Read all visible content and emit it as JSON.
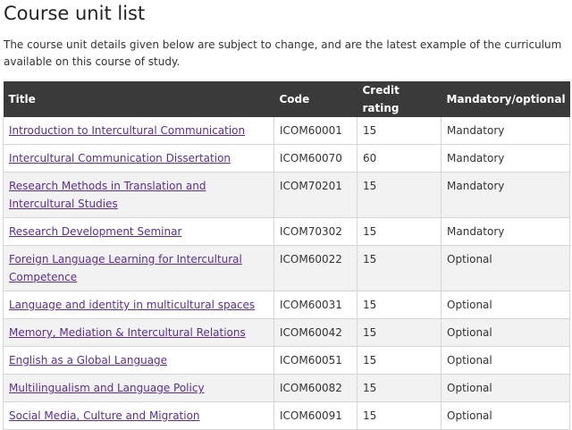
{
  "page": {
    "title": "Course unit list",
    "intro": "The course unit details given below are subject to change, and are the latest example of the curriculum available on this course of study."
  },
  "table": {
    "headers": [
      "Title",
      "Code",
      "Credit rating",
      "Mandatory/optional"
    ],
    "rows": [
      {
        "title": "Introduction to Intercultural Communication",
        "code": "ICOM60001",
        "credit": "15",
        "status": "Mandatory"
      },
      {
        "title": "Intercultural Communication Dissertation",
        "code": "ICOM60070",
        "credit": "60",
        "status": "Mandatory"
      },
      {
        "title": "Research Methods in Translation and Intercultural Studies",
        "code": "ICOM70201",
        "credit": "15",
        "status": "Mandatory"
      },
      {
        "title": "Research Development Seminar",
        "code": "ICOM70302",
        "credit": "15",
        "status": "Mandatory"
      },
      {
        "title": "Foreign Language Learning for Intercultural Competence",
        "code": "ICOM60022",
        "credit": "15",
        "status": "Optional"
      },
      {
        "title": "Language and identity in multicultural spaces",
        "code": "ICOM60031",
        "credit": "15",
        "status": "Optional"
      },
      {
        "title": "Memory, Mediation & Intercultural Relations",
        "code": "ICOM60042",
        "credit": "15",
        "status": "Optional"
      },
      {
        "title": "English as a Global Language",
        "code": "ICOM60051",
        "credit": "15",
        "status": "Optional"
      },
      {
        "title": "Multilingualism and Language Policy",
        "code": "ICOM60082",
        "credit": "15",
        "status": "Optional"
      },
      {
        "title": "Social Media, Culture and Migration",
        "code": "ICOM60091",
        "credit": "15",
        "status": "Optional"
      }
    ]
  },
  "colors": {
    "header_bg": "#3a3a3a",
    "link": "#5c2d91",
    "row_alt": "#f2f2f2",
    "border": "#d6d6d6"
  }
}
